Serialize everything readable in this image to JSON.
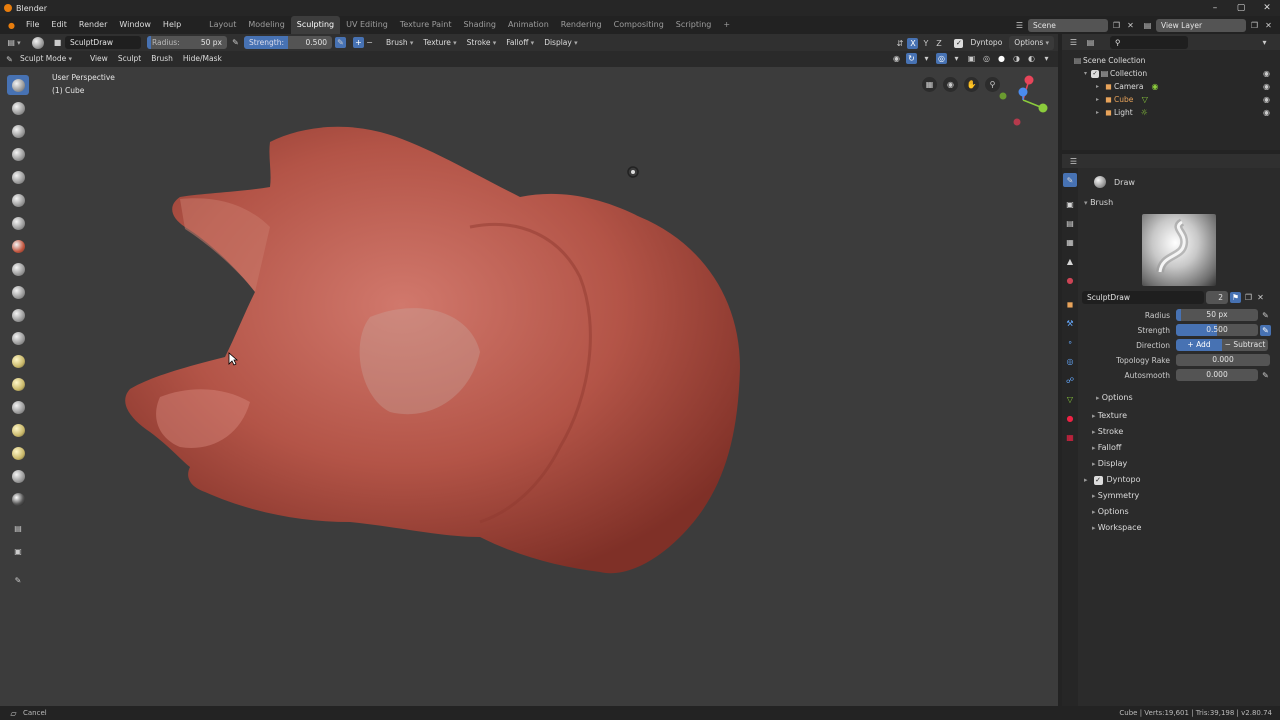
{
  "window": {
    "title": "Blender",
    "controls": [
      "–",
      "▢",
      "✕"
    ]
  },
  "menu": {
    "items": [
      "File",
      "Edit",
      "Render",
      "Window",
      "Help"
    ]
  },
  "tabs": [
    "Layout",
    "Modeling",
    "Sculpting",
    "UV Editing",
    "Texture Paint",
    "Shading",
    "Animation",
    "Rendering",
    "Compositing",
    "Scripting"
  ],
  "active_tab": "Sculpting",
  "add_tab": "+",
  "scene": {
    "name": "Scene",
    "view_layer": "View Layer"
  },
  "tool_header": {
    "brush_name": "SculptDraw",
    "radius_label": "Radius:",
    "radius_value": "50 px",
    "strength_label": "Strength:",
    "strength_value": "0.500",
    "plus": "+",
    "minus": "−",
    "dropdowns": [
      "Brush",
      "Texture",
      "Stroke",
      "Falloff",
      "Display"
    ],
    "axes": [
      "X",
      "Y",
      "Z"
    ],
    "dyntopo": "Dyntopo",
    "options": "Options"
  },
  "mode_header": {
    "mode": "Sculpt Mode",
    "menus": [
      "View",
      "Sculpt",
      "Brush",
      "Hide/Mask"
    ]
  },
  "viewport": {
    "perspective": "User Perspective",
    "object": "(1) Cube"
  },
  "outliner": {
    "root": "Scene Collection",
    "collection": "Collection",
    "items": [
      {
        "name": "Camera",
        "color": "#dcdcdc"
      },
      {
        "name": "Cube",
        "color": "#e8a35a"
      },
      {
        "name": "Light",
        "color": "#dcdcdc"
      }
    ]
  },
  "properties": {
    "brush_tool": "Draw",
    "brush_section": "Brush",
    "brush_name": "SculptDraw",
    "brush_users": "2",
    "rows": [
      {
        "label": "Radius",
        "value": "50 px",
        "fill": 0.06
      },
      {
        "label": "Strength",
        "value": "0.500",
        "fill": 0.5
      },
      {
        "label": "Topology Rake",
        "value": "0.000",
        "fill": 0
      },
      {
        "label": "Autosmooth",
        "value": "0.000",
        "fill": 0
      }
    ],
    "direction_label": "Direction",
    "direction_add": "Add",
    "direction_subtract": "Subtract",
    "options_sub": "Options",
    "panels": [
      "Texture",
      "Stroke",
      "Falloff",
      "Display"
    ],
    "dyntopo_panel": "Dyntopo",
    "panels2": [
      "Symmetry",
      "Options",
      "Workspace"
    ]
  },
  "status": {
    "left": "Cancel",
    "right": "Cube | Verts:19,601 | Tris:39,198 | v2.80.74"
  },
  "colors": {
    "accent": "#4772b3",
    "mesh": "#b9564a",
    "bg": "#3c3c3c"
  }
}
